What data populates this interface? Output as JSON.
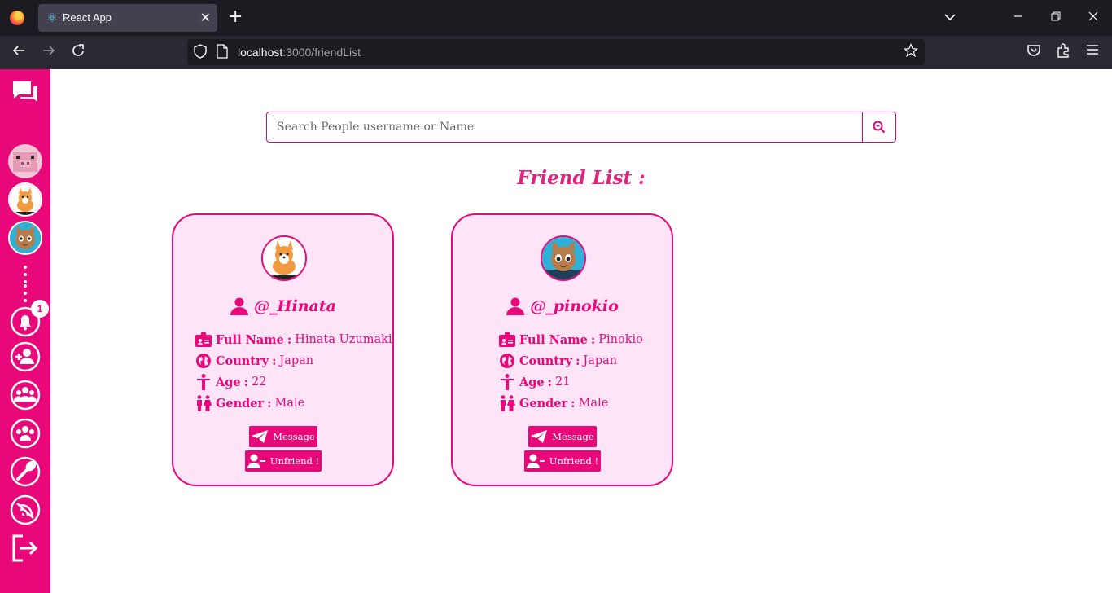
{
  "browser": {
    "tab_title": "React App",
    "url_host": "localhost",
    "url_path": ":3000/friendList"
  },
  "sidebar": {
    "notification_count": "1",
    "items": [
      "chat-icon",
      "avatar-pig",
      "avatar-corgi",
      "avatar-cat",
      "more-dots-icon",
      "notification-bell-icon",
      "add-friend-icon",
      "groups-icon",
      "friends-icon",
      "settings-wrench-icon",
      "wifi-off-icon",
      "logout-icon"
    ]
  },
  "search": {
    "placeholder": "Search People username or Name"
  },
  "main": {
    "heading": "Friend List :"
  },
  "labels": {
    "full_name": "Full Name",
    "country": "Country",
    "age": "Age",
    "gender": "Gender",
    "colon": ":",
    "message": "Message",
    "unfriend": "Unfriend !"
  },
  "friends": [
    {
      "username": "@_Hinata",
      "full_name": "Hinata Uzumaki",
      "country": "Japan",
      "age": "22",
      "gender": "Male",
      "avatar": "corgi"
    },
    {
      "username": "@_pinokio",
      "full_name": "Pinokio",
      "country": "Japan",
      "age": "21",
      "gender": "Male",
      "avatar": "cat"
    }
  ],
  "colors": {
    "accent": "#e8087a",
    "card_bg": "#fde4f7",
    "heading": "#e0237f"
  }
}
